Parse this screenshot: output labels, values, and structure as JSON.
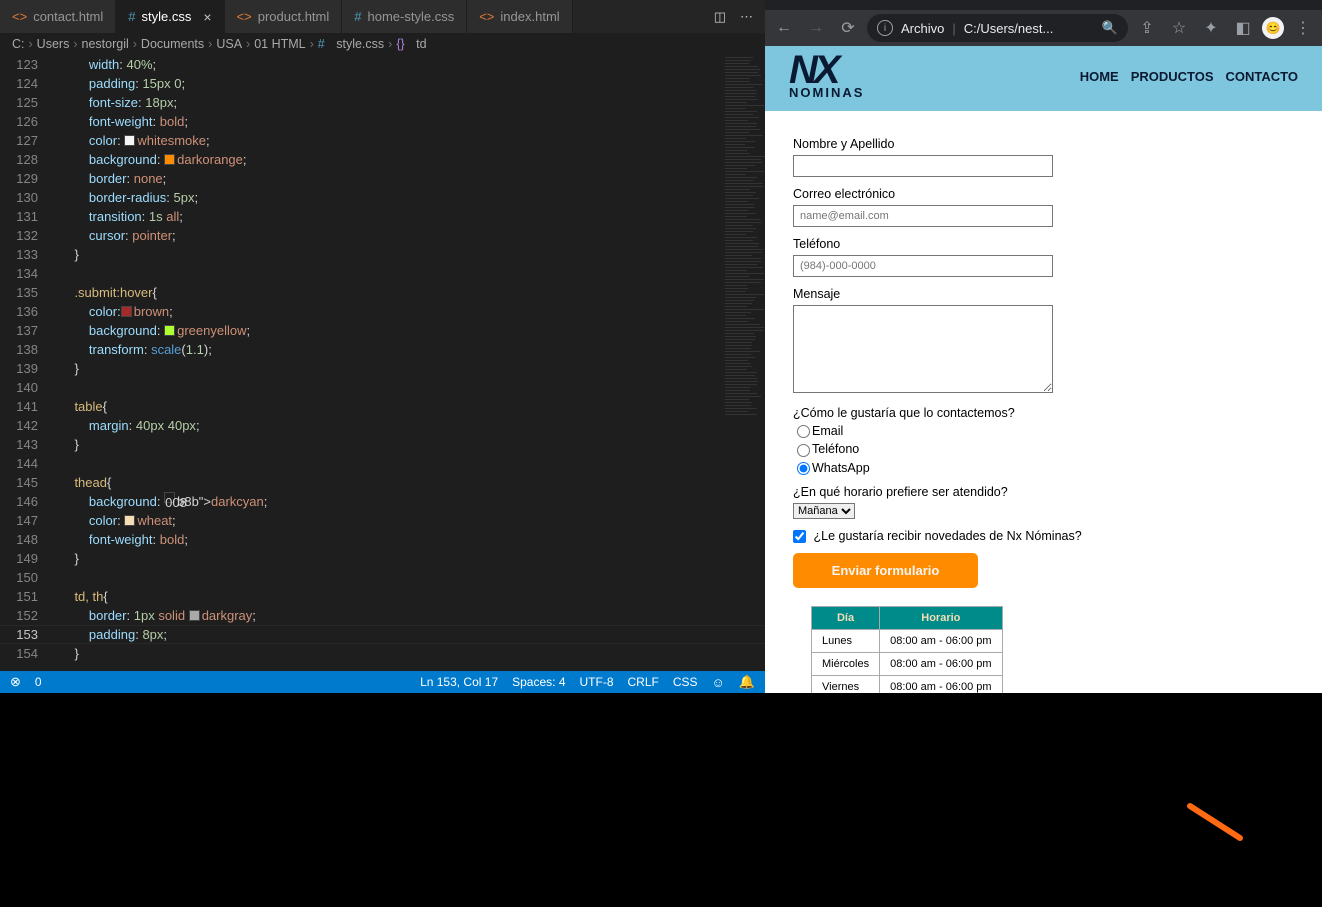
{
  "vscode": {
    "tabs": [
      {
        "label": "contact.html",
        "icon": "<>",
        "iconColor": "orange",
        "active": false
      },
      {
        "label": "style.css",
        "icon": "#",
        "iconColor": "blue",
        "active": true
      },
      {
        "label": "product.html",
        "icon": "<>",
        "iconColor": "orange",
        "active": false
      },
      {
        "label": "home-style.css",
        "icon": "#",
        "iconColor": "blue",
        "active": false
      },
      {
        "label": "index.html",
        "icon": "<>",
        "iconColor": "orange",
        "active": false
      }
    ],
    "breadcrumb": {
      "parts": [
        "C:",
        "Users",
        "nestorgil",
        "Documents",
        "USA",
        "01 HTML"
      ],
      "fileIcon": "#",
      "file": "style.css",
      "symbolIcon": "{}",
      "symbol": "td"
    },
    "lineStart": 123,
    "lineEnd": 154,
    "currentLine": 153,
    "code": [
      "        width: 40%;",
      "        padding: 15px 0;",
      "        font-size: 18px;",
      "        font-weight: bold;",
      "        color: ▢whitesmoke;",
      "        background: ▢darkorange;",
      "        border: none;",
      "        border-radius: 5px;",
      "        transition: 1s all;",
      "        cursor: pointer;",
      "    }",
      "",
      "    .submit:hover{",
      "        color:▢brown;",
      "        background: ▢greenyellow;",
      "        transform: scale(1.1);",
      "    }",
      "",
      "    table{",
      "        margin: 40px 40px;",
      "    }",
      "",
      "    thead{",
      "        background: ▢darkcyan;",
      "        color: ▢wheat;",
      "        font-weight: bold;",
      "    }",
      "",
      "    td, th{",
      "        border: 1px solid ▢darkgray;",
      "        padding: 8px;",
      "    }"
    ],
    "swatches": {
      "whitesmoke": "#f5f5f5",
      "darkorange": "#ff8c00",
      "brown": "#a52a2a",
      "greenyellow": "#adff2f",
      "darkcyan": "#008b8b",
      "wheat": "#f5deb3",
      "darkgray": "#a9a9a9"
    },
    "status": {
      "errors": "0",
      "cursor": "Ln 153, Col 17",
      "spaces": "Spaces: 4",
      "enc": "UTF-8",
      "eol": "CRLF",
      "lang": "CSS"
    }
  },
  "browser": {
    "url_prefix": "Archivo",
    "url_sep": "|",
    "url": "C:/Users/nest...",
    "profile_initial": "😊"
  },
  "site": {
    "logo_main": "NX",
    "logo_sub": "NOMINAS",
    "nav": [
      "HOME",
      "PRODUCTOS",
      "CONTACTO"
    ],
    "form": {
      "name_label": "Nombre y Apellido",
      "email_label": "Correo electrónico",
      "email_placeholder": "name@email.com",
      "phone_label": "Teléfono",
      "phone_placeholder": "(984)-000-0000",
      "message_label": "Mensaje",
      "contact_q": "¿Cómo le gustaría que lo contactemos?",
      "opt_email": "Email",
      "opt_phone": "Teléfono",
      "opt_wa": "WhatsApp",
      "schedule_q": "¿En qué horario prefiere ser atendido?",
      "schedule_selected": "Mañana",
      "news_label": "¿Le gustaría recibir novedades de Nx Nóminas?",
      "submit": "Enviar formulario"
    },
    "table": {
      "headers": [
        "Día",
        "Horario"
      ],
      "rows": [
        [
          "Lunes",
          "08:00 am - 06:00 pm"
        ],
        [
          "Miércoles",
          "08:00 am - 06:00 pm"
        ],
        [
          "Viernes",
          "08:00 am - 06:00 pm"
        ]
      ]
    }
  }
}
